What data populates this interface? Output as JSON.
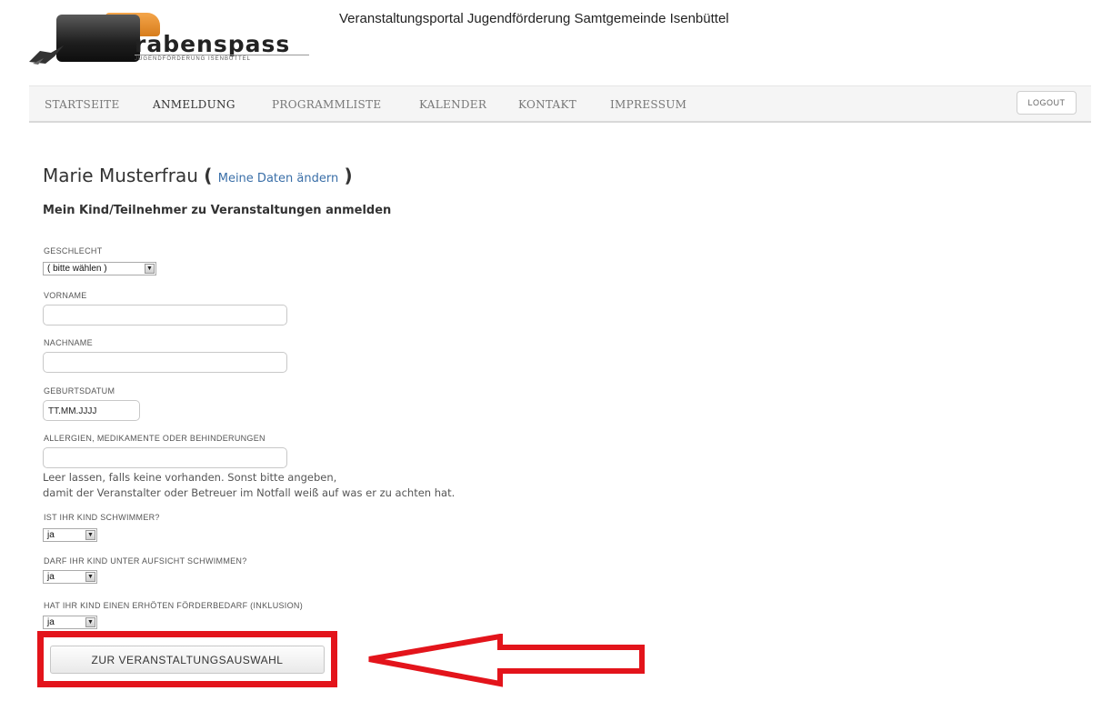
{
  "header": {
    "logo_text": "rabenspass",
    "logo_subtext": "JUGENDFÖRDERUNG ISENBÜTTEL",
    "site_title": "Veranstaltungsportal Jugendförderung Samtgemeinde Isenbüttel"
  },
  "nav": {
    "items": [
      {
        "label": "STARTSEITE"
      },
      {
        "label": "ANMELDUNG"
      },
      {
        "label": "PROGRAMMLISTE"
      },
      {
        "label": "KALENDER"
      },
      {
        "label": "KONTAKT"
      },
      {
        "label": "IMPRESSUM"
      }
    ],
    "active": "ANMELDUNG",
    "logout_label": "LOGOUT"
  },
  "content": {
    "user_name": "Marie Musterfrau",
    "paren_open": "(",
    "paren_close": ")",
    "edit_link": "Meine Daten ändern",
    "subheading": "Mein Kind/Teilnehmer zu Veranstaltungen anmelden",
    "hint_line1": "Leer lassen, falls keine vorhanden. Sonst bitte angeben,",
    "hint_line2": "damit der Veranstalter oder Betreuer im Notfall weiß auf was er zu achten hat."
  },
  "form": {
    "geschlecht": {
      "label": "GESCHLECHT",
      "value": "( bitte wählen )"
    },
    "vorname": {
      "label": "VORNAME",
      "value": ""
    },
    "nachname": {
      "label": "NACHNAME",
      "value": ""
    },
    "geburtsdatum": {
      "label": "GEBURTSDATUM",
      "value": "TT.MM.JJJJ"
    },
    "allergien": {
      "label": "ALLERGIEN, MEDIKAMENTE ODER BEHINDERUNGEN",
      "value": ""
    },
    "schwimmer": {
      "label": "IST IHR KIND SCHWIMMER?",
      "value": "ja"
    },
    "aufsicht": {
      "label": "DARF IHR KIND UNTER AUFSICHT SCHWIMMEN?",
      "value": "ja"
    },
    "foerderbedarf": {
      "label": "HAT IHR KIND EINEN ERHÖTEN FÖRDERBEDARF (INKLUSION)",
      "value": "ja"
    },
    "submit_label": "ZUR VERANSTALTUNGSAUSWAHL"
  },
  "colors": {
    "annotation": "#e3141b",
    "link": "#3a6fa8"
  }
}
